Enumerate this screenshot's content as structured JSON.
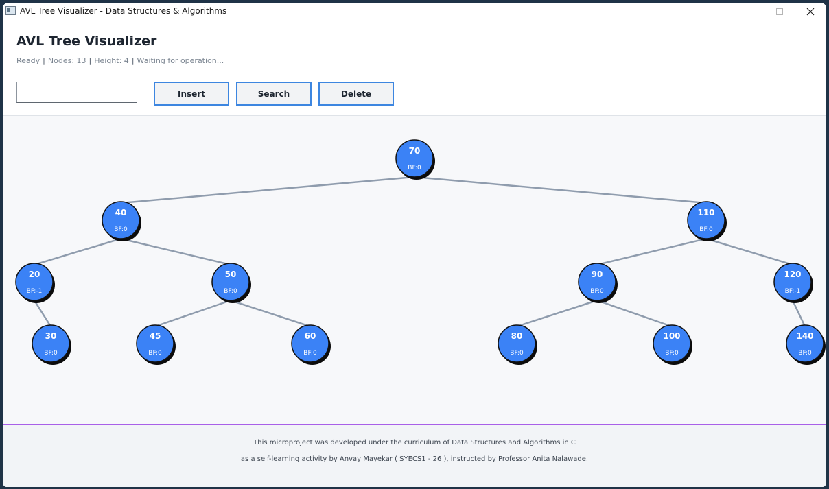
{
  "window": {
    "title": "AVL Tree Visualizer - Data Structures & Algorithms",
    "minimize_icon": "minimize-icon",
    "maximize_icon": "maximize-icon",
    "close_icon": "close-icon"
  },
  "header": {
    "title": "AVL Tree Visualizer",
    "status": {
      "state": "Ready",
      "nodes": "Nodes: 13",
      "height": "Height: 4",
      "message": "Waiting for operation...",
      "separator": "|"
    }
  },
  "controls": {
    "input_value": "",
    "input_placeholder": "",
    "insert_label": "Insert",
    "search_label": "Search",
    "delete_label": "Delete",
    "button_border_color": "#3d86e0"
  },
  "tree": {
    "node_color": "#3b82f6",
    "edge_color": "#8f9cad",
    "nodes": [
      {
        "key": 70,
        "bf": "BF:0",
        "depth": 0,
        "order": 6
      },
      {
        "key": 40,
        "bf": "BF:0",
        "depth": 1,
        "order": 3
      },
      {
        "key": 110,
        "bf": "BF:0",
        "depth": 1,
        "order": 10
      },
      {
        "key": 20,
        "bf": "BF:-1",
        "depth": 2,
        "order": 0
      },
      {
        "key": 50,
        "bf": "BF:0",
        "depth": 2,
        "order": 4
      },
      {
        "key": 90,
        "bf": "BF:0",
        "depth": 2,
        "order": 8
      },
      {
        "key": 120,
        "bf": "BF:-1",
        "depth": 2,
        "order": 11
      },
      {
        "key": 30,
        "bf": "BF:0",
        "depth": 3,
        "order": 1
      },
      {
        "key": 45,
        "bf": "BF:0",
        "depth": 3,
        "order": 2
      },
      {
        "key": 60,
        "bf": "BF:0",
        "depth": 3,
        "order": 5
      },
      {
        "key": 80,
        "bf": "BF:0",
        "depth": 3,
        "order": 7
      },
      {
        "key": 100,
        "bf": "BF:0",
        "depth": 3,
        "order": 9
      },
      {
        "key": 140,
        "bf": "BF:0",
        "depth": 3,
        "order": 12
      }
    ],
    "edges": [
      [
        70,
        40
      ],
      [
        70,
        110
      ],
      [
        40,
        20
      ],
      [
        40,
        50
      ],
      [
        110,
        90
      ],
      [
        110,
        120
      ],
      [
        20,
        30
      ],
      [
        50,
        45
      ],
      [
        50,
        60
      ],
      [
        90,
        80
      ],
      [
        90,
        100
      ],
      [
        120,
        140
      ]
    ]
  },
  "footer": {
    "line1": "This microproject was developed under the curriculum of Data Structures and Algorithms in C",
    "line2": "as a self-learning activity by Anvay Mayekar ( SYECS1 - 26 ), instructed by Professor Anita Nalawade.",
    "accent_color": "#a960e8"
  }
}
